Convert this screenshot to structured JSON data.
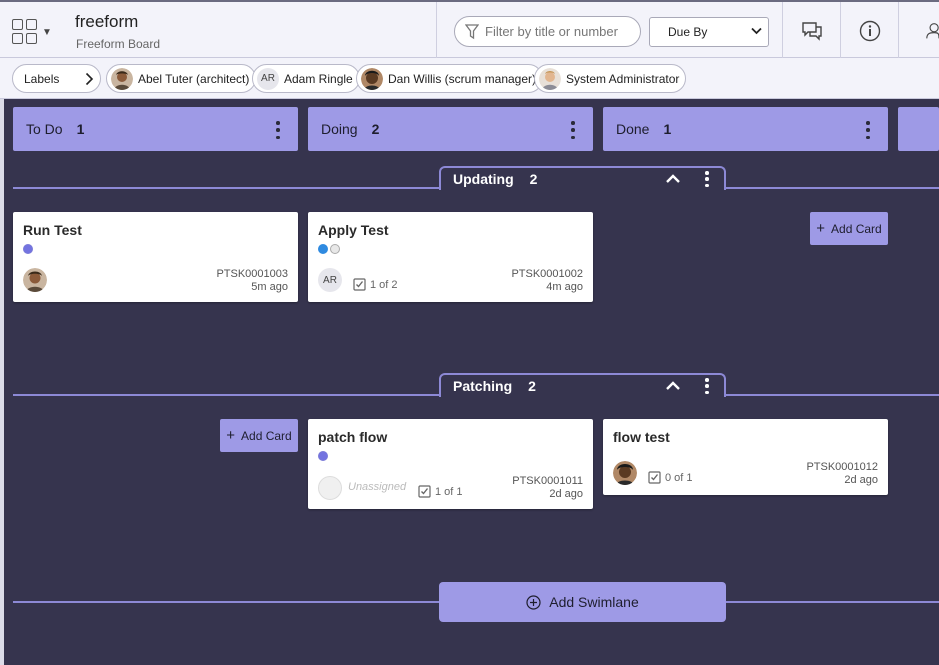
{
  "header": {
    "board_title": "freeform",
    "board_subtitle": "Freeform Board",
    "filter_placeholder": "Filter by title or number",
    "sort_value": "Due By"
  },
  "chips": [
    {
      "label": "Labels"
    },
    {
      "label": "Abel Tuter (architect)"
    },
    {
      "label": "Adam Ringle",
      "initials": "AR"
    },
    {
      "label": "Dan Willis (scrum manager)"
    },
    {
      "label": "System Administrator"
    }
  ],
  "columns": [
    {
      "name": "To Do",
      "count": "1"
    },
    {
      "name": "Doing",
      "count": "2"
    },
    {
      "name": "Done",
      "count": "1"
    }
  ],
  "swimlanes": [
    {
      "name": "Updating",
      "count": "2",
      "cards": [
        {
          "title": "Run Test",
          "number": "PTSK0001003",
          "age": "5m ago"
        },
        {
          "title": "Apply Test",
          "number": "PTSK0001002",
          "age": "4m ago",
          "initials": "AR",
          "checklist": "1 of 2"
        }
      ],
      "add_card": "Add Card"
    },
    {
      "name": "Patching",
      "count": "2",
      "cards": [
        {
          "title": "patch flow",
          "number": "PTSK0001011",
          "age": "2d ago",
          "assignee": "Unassigned",
          "checklist": "1 of 1"
        },
        {
          "title": "flow test",
          "number": "PTSK0001012",
          "age": "2d ago",
          "checklist": "0 of 1"
        }
      ],
      "add_card": "Add Card"
    }
  ],
  "add_swimlane": "Add Swimlane",
  "colors": {
    "accent": "#9e9ae6",
    "board_bg": "#36344e",
    "lane_line": "#8d89d6"
  }
}
